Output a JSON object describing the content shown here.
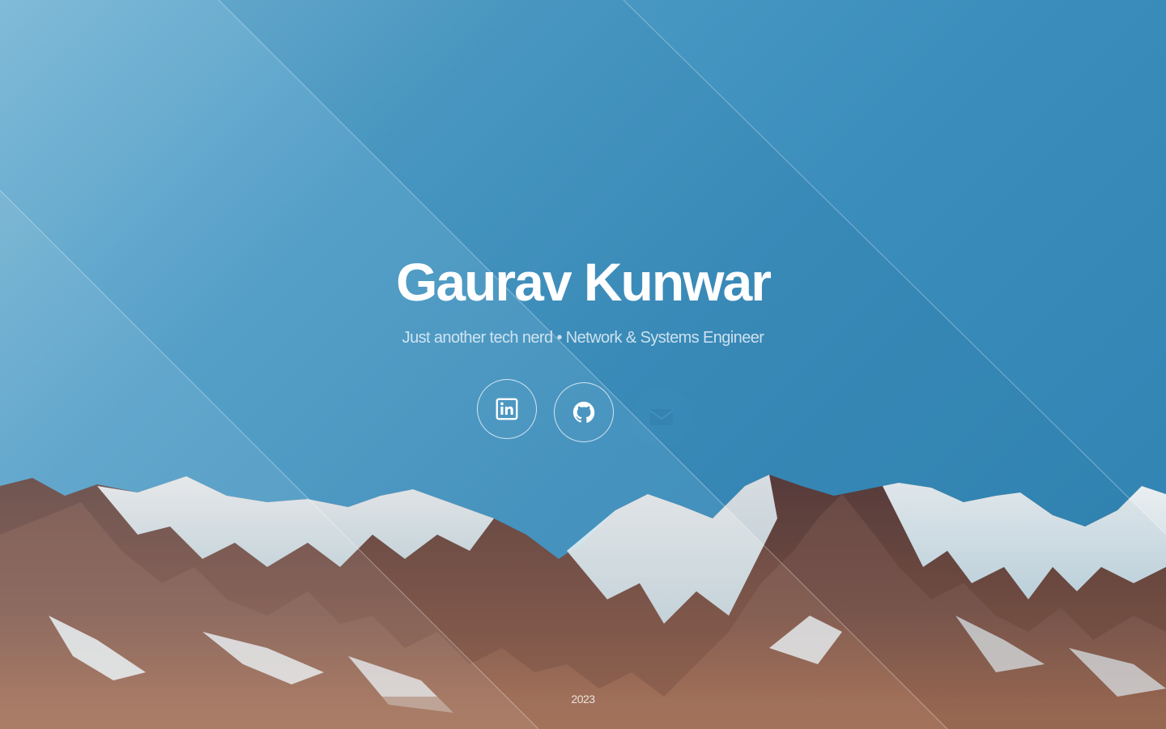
{
  "profile": {
    "name": "Gaurav Kunwar",
    "tagline": "Just another tech nerd • Network & Systems Engineer"
  },
  "social_links": [
    {
      "id": "linkedin",
      "icon": "linkedin-icon"
    },
    {
      "id": "github",
      "icon": "github-icon"
    },
    {
      "id": "email",
      "icon": "envelope-icon"
    }
  ],
  "footer": {
    "year": "2023"
  },
  "colors": {
    "sky_light": "#79b7d6",
    "sky_mid": "#3b8dbb",
    "sky_dark": "#2f82b1",
    "snow": "#e6f2f7",
    "rock": "#8a5a4e",
    "text": "#ffffff"
  }
}
